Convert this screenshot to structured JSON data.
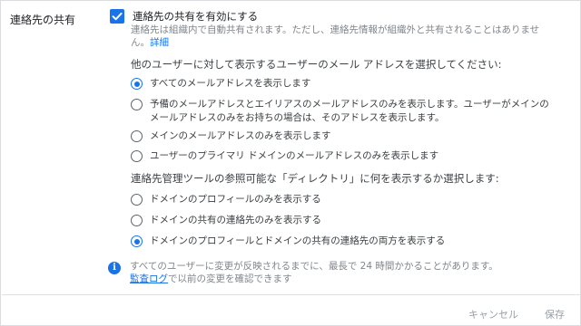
{
  "section": {
    "label": "連絡先の共有"
  },
  "enable": {
    "label": "連絡先の共有を有効にする",
    "checked": true,
    "description": "連絡先は組織内で自動共有されます。ただし、連絡先情報が組織外と共有されることはありません。",
    "details_link": "詳細"
  },
  "email_question": "他のユーザーに対して表示するユーザーのメール アドレスを選択してください:",
  "email_options": [
    {
      "label": "すべてのメールアドレスを表示します",
      "checked": true
    },
    {
      "label": "予備のメールアドレスとエイリアスのメールアドレスのみを表示します。ユーザーがメインのメールアドレスのみをお持ちの場合は、そのアドレスを表示します。",
      "checked": false
    },
    {
      "label": "メインのメールアドレスのみを表示します",
      "checked": false
    },
    {
      "label": "ユーザーのプライマリ ドメインのメールアドレスのみを表示します",
      "checked": false
    }
  ],
  "directory_question": "連絡先管理ツールの参照可能な「ディレクトリ」に何を表示するか選択します:",
  "directory_options": [
    {
      "label": "ドメインのプロフィールのみを表示する",
      "checked": false
    },
    {
      "label": "ドメインの共有の連絡先のみを表示する",
      "checked": false
    },
    {
      "label": "ドメインのプロフィールとドメインの共有の連絡先の両方を表示する",
      "checked": true
    }
  ],
  "info": {
    "icon": "info-icon",
    "text_before": "すべてのユーザーに変更が反映されるまでに、最長で 24 時間かかることがあります。",
    "audit_link": "監査ログ",
    "text_after": "で以前の変更を確認できます"
  },
  "footer": {
    "cancel_label": "キャンセル",
    "save_label": "保存"
  },
  "colors": {
    "accent": "#1a73e8",
    "text": "#3c4043",
    "muted": "#80868b",
    "disabled": "#9aa0a6"
  }
}
